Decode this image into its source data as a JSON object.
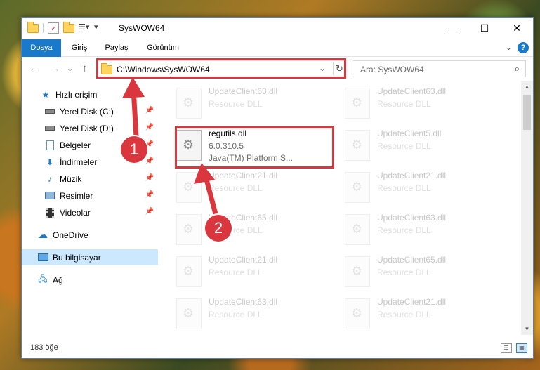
{
  "window": {
    "title": "SysWOW64",
    "controls": {
      "minimize": "—",
      "maximize": "☐",
      "close": "✕"
    }
  },
  "ribbon": {
    "tabs": [
      "Dosya",
      "Giriş",
      "Paylaş",
      "Görünüm"
    ],
    "help": "?"
  },
  "nav": {
    "back": "←",
    "forward": "→",
    "recent": "⌄",
    "up": "↑",
    "address": "C:\\Windows\\SysWOW64",
    "address_dropdown": "⌄",
    "refresh": "↻"
  },
  "search": {
    "placeholder": "Ara: SysWOW64"
  },
  "sidebar": {
    "items": [
      {
        "label": "Hızlı erişim",
        "icon": "star-icon"
      },
      {
        "label": "Yerel Disk (C:)",
        "icon": "drive-icon",
        "pinned": true
      },
      {
        "label": "Yerel Disk (D:)",
        "icon": "drive-icon",
        "pinned": true
      },
      {
        "label": "Belgeler",
        "icon": "document-icon",
        "pinned": true
      },
      {
        "label": "İndirmeler",
        "icon": "download-icon",
        "pinned": true
      },
      {
        "label": "Müzik",
        "icon": "music-icon",
        "pinned": true
      },
      {
        "label": "Resimler",
        "icon": "pictures-icon",
        "pinned": true
      },
      {
        "label": "Videolar",
        "icon": "video-icon",
        "pinned": true
      },
      {
        "label": "OneDrive",
        "icon": "cloud-icon"
      },
      {
        "label": "Bu bilgisayar",
        "icon": "computer-icon",
        "selected": true
      },
      {
        "label": "Ağ",
        "icon": "network-icon"
      }
    ]
  },
  "files": {
    "highlighted": {
      "name": "regutils.dll",
      "version": "6.0.310.5",
      "description": "Java(TM) Platform S..."
    },
    "left_column": [
      {
        "name": "UpdateClient63.dll",
        "description": "Resource DLL"
      },
      {
        "name": "UpdateClient21.dll",
        "description": "Resource DLL"
      },
      {
        "name": "UpdateClient65.dll",
        "description": "Resource DLL"
      },
      {
        "name": "UpdateClient21.dll",
        "description": "Resource DLL"
      },
      {
        "name": "UpdateClient63.dll",
        "description": "Resource DLL"
      }
    ],
    "right_column": [
      {
        "name": "UpdateClient63.dll",
        "description": "Resource DLL"
      },
      {
        "name": "UpdateClient5.dll",
        "description": "Resource DLL"
      },
      {
        "name": "UpdateClient21.dll",
        "description": "Resource DLL"
      },
      {
        "name": "UpdateClient63.dll",
        "description": "Resource DLL"
      },
      {
        "name": "UpdateClient65.dll",
        "description": "Resource DLL"
      },
      {
        "name": "UpdateClient21.dll",
        "description": "Resource DLL"
      }
    ]
  },
  "status": {
    "item_count": "183 öğe"
  },
  "annotations": {
    "badge1": "1",
    "badge2": "2",
    "color": "#d9363e"
  }
}
